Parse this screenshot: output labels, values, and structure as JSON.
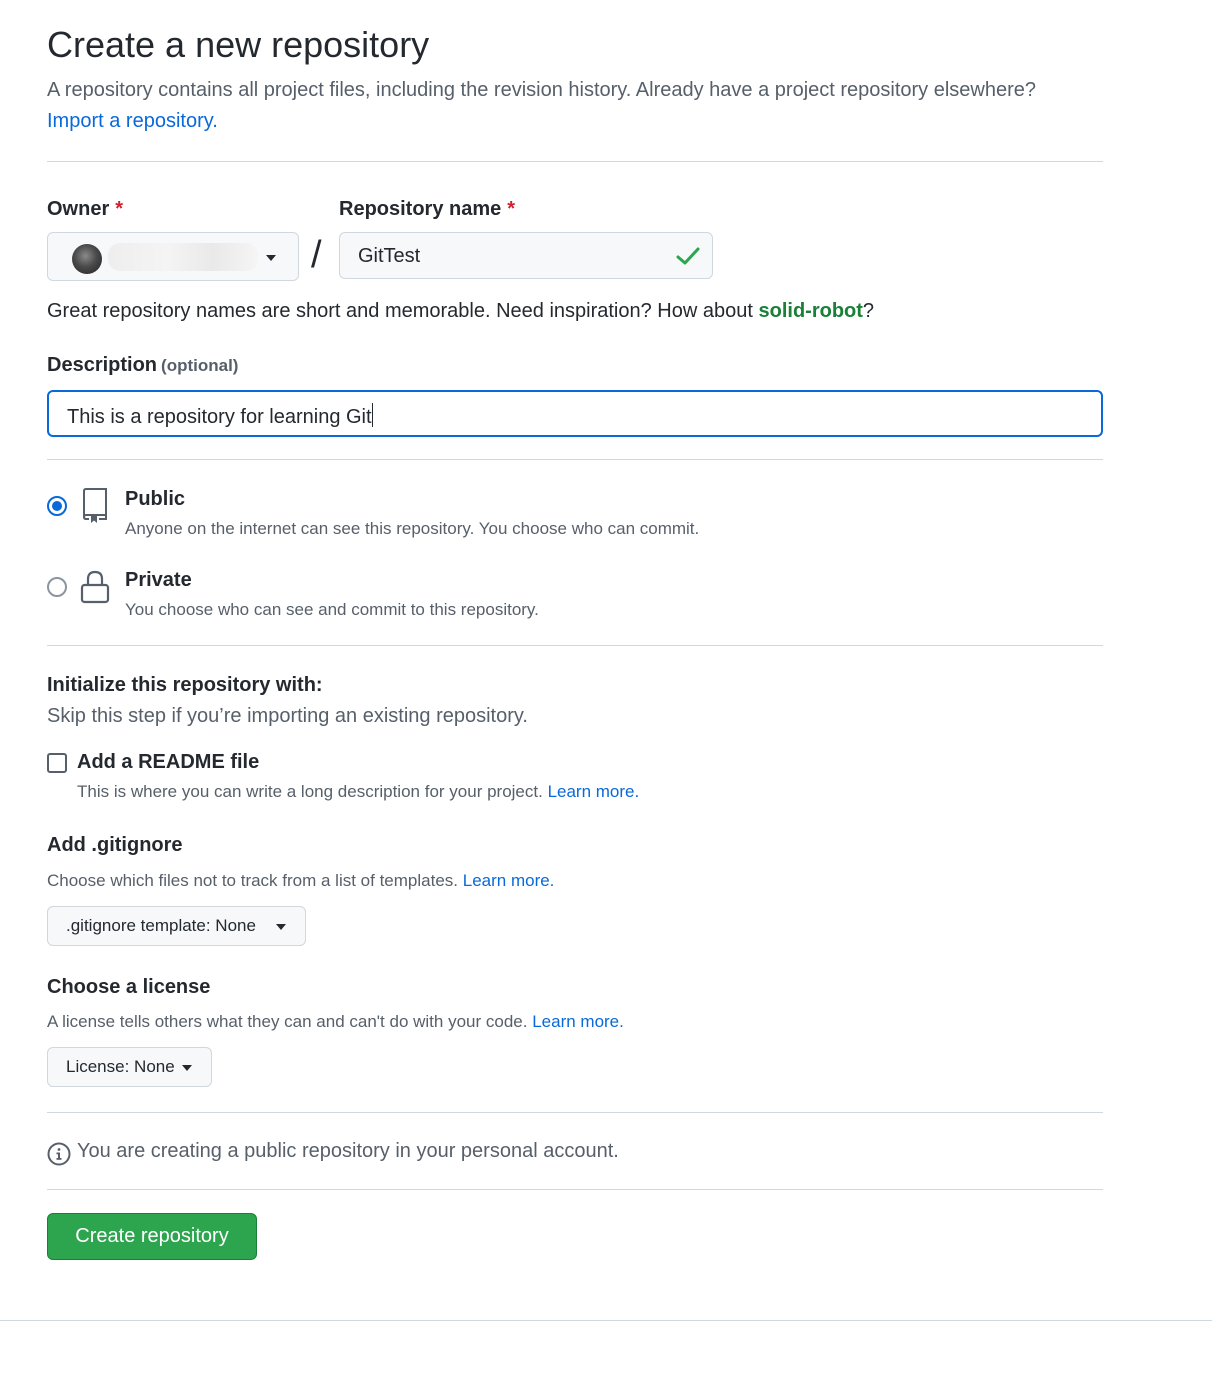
{
  "header": {
    "title": "Create a new repository",
    "subtitle": "A repository contains all project files, including the revision history. Already have a project repository elsewhere?",
    "import_link": "Import a repository."
  },
  "owner": {
    "label": "Owner",
    "required_mark": "*"
  },
  "repo_name": {
    "label": "Repository name",
    "required_mark": "*",
    "value": "GitTest",
    "slash": "/"
  },
  "hint": {
    "prefix": "Great repository names are short and memorable. Need inspiration? How about ",
    "suggestion": "solid-robot",
    "suffix": "?"
  },
  "description": {
    "label": "Description",
    "optional": "(optional)",
    "value": "This is a repository for learning Git"
  },
  "visibility": {
    "public": {
      "title": "Public",
      "desc": "Anyone on the internet can see this repository. You choose who can commit.",
      "selected": true
    },
    "private": {
      "title": "Private",
      "desc": "You choose who can see and commit to this repository.",
      "selected": false
    }
  },
  "init": {
    "title": "Initialize this repository with:",
    "subtitle": "Skip this step if you’re importing an existing repository.",
    "readme_label": "Add a README file",
    "readme_desc": "This is where you can write a long description for your project.",
    "readme_learn": "Learn more.",
    "readme_checked": false
  },
  "gitignore": {
    "title": "Add .gitignore",
    "desc": "Choose which files not to track from a list of templates.",
    "learn": "Learn more.",
    "select_label": ".gitignore template: None"
  },
  "license": {
    "title": "Choose a license",
    "desc": "A license tells others what they can and can't do with your code.",
    "learn": "Learn more.",
    "select_label": "License: None"
  },
  "notice": "You are creating a public repository in your personal account.",
  "submit_label": "Create repository",
  "colors": {
    "accent": "#0969da",
    "success": "#2da44e",
    "suggestion": "#1a7f37",
    "required": "#cf222e"
  }
}
